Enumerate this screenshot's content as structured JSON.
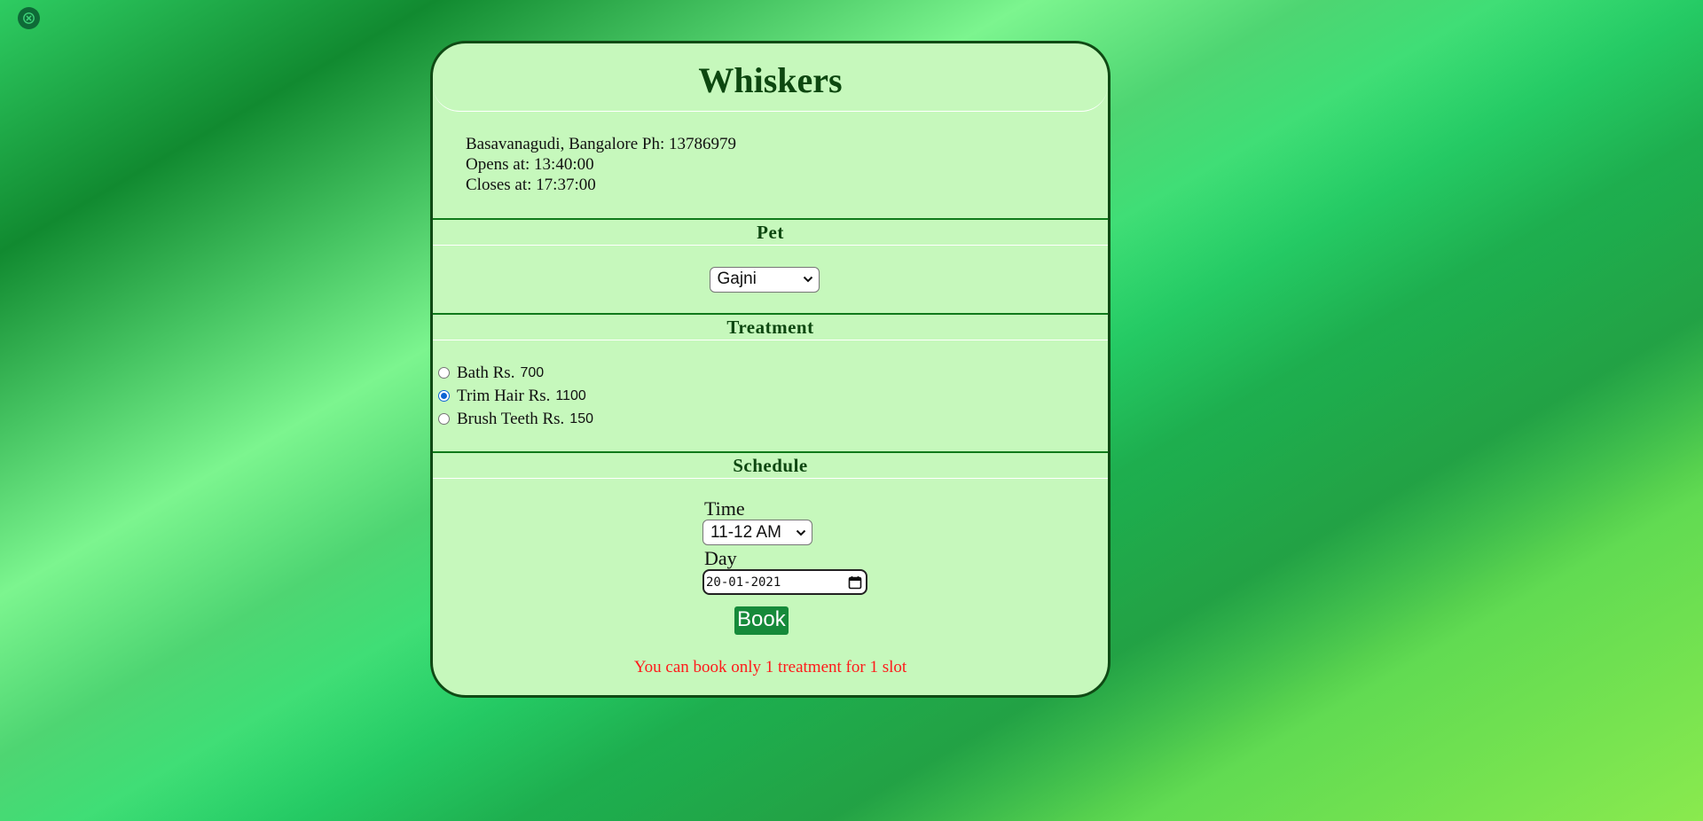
{
  "colors": {
    "card_background": "#c6f8bc",
    "card_border": "#0f4a14",
    "heading": "#0d4710",
    "book_button": "#168a3a",
    "warning": "#ff1a1a",
    "close_button": "#0e6a37"
  },
  "close_icon": "close-icon",
  "shop": {
    "name": "Whiskers",
    "address_line": "Basavanagudi, Bangalore Ph: 13786979",
    "opens": "Opens at: 13:40:00",
    "closes": "Closes at: 17:37:00"
  },
  "pet": {
    "heading": "Pet",
    "selected": "Gajni",
    "dropdown_icon": "chevron-down-icon"
  },
  "treatment": {
    "heading": "Treatment",
    "options": [
      {
        "label": "Bath Rs.",
        "price": "700",
        "checked": false
      },
      {
        "label": "Trim Hair Rs.",
        "price": "1100",
        "checked": true
      },
      {
        "label": "Brush Teeth Rs.",
        "price": "150",
        "checked": false
      }
    ]
  },
  "schedule": {
    "heading": "Schedule",
    "time_label": "Time",
    "time_selected": "11-12 AM",
    "day_label": "Day",
    "day_value": "20-01-2021",
    "calendar_icon": "calendar-icon",
    "book_label": "Book",
    "warning": "You can book only 1 treatment for 1 slot"
  }
}
